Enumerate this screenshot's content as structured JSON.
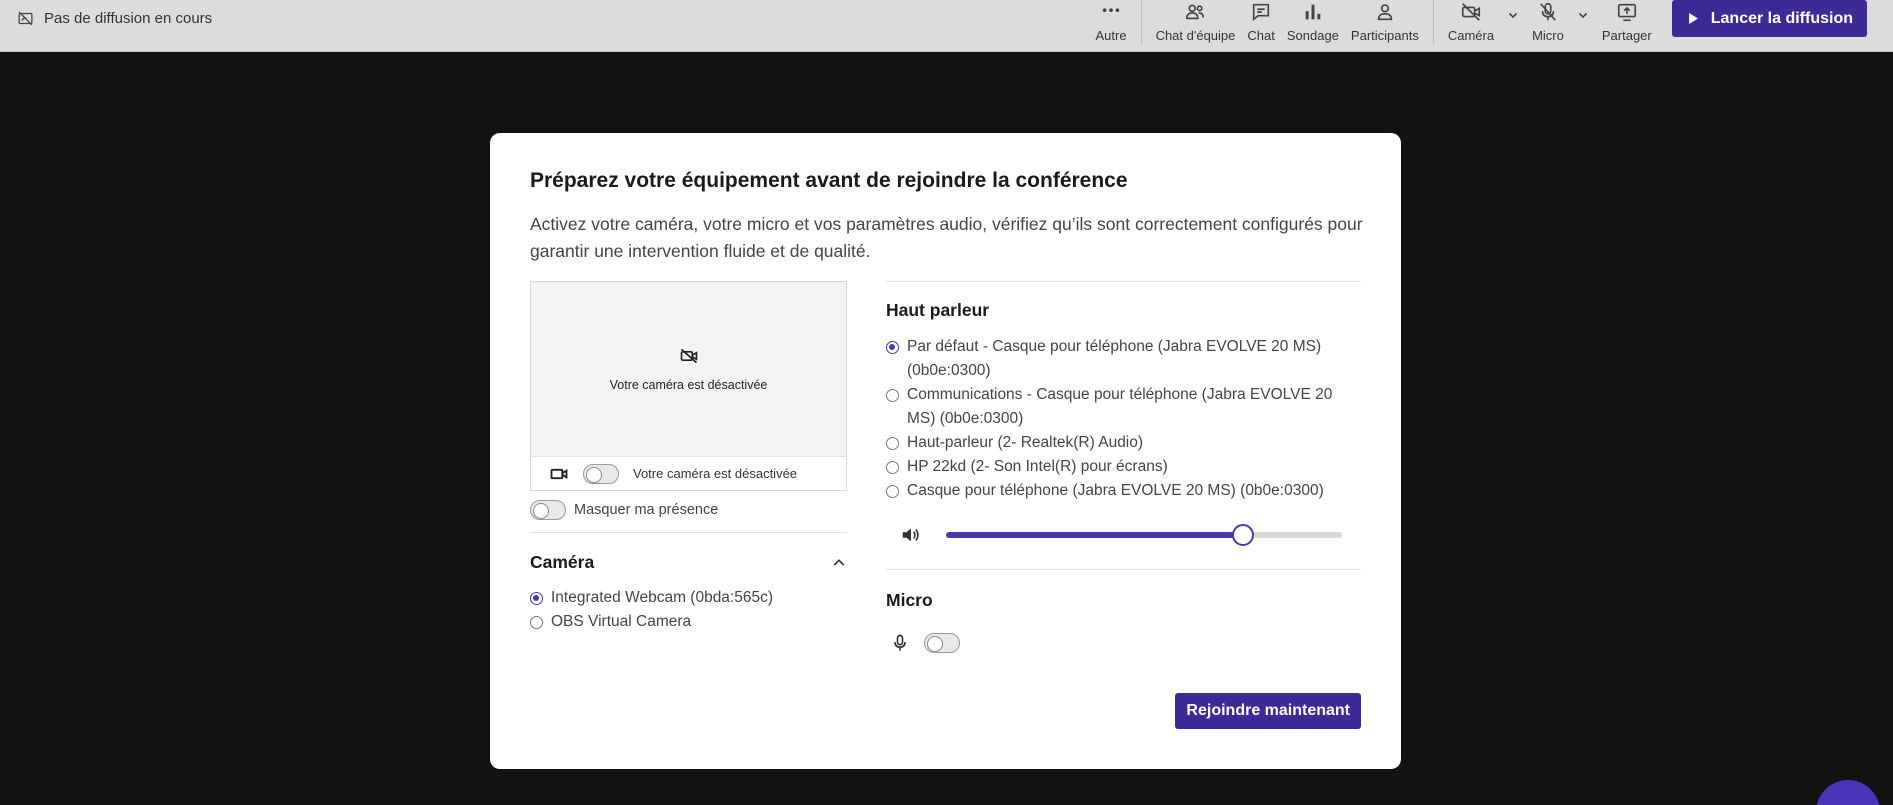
{
  "topbar": {
    "broadcast_status": "Pas de diffusion en cours",
    "tools": {
      "more": "Autre",
      "team_chat": "Chat d'équipe",
      "chat": "Chat",
      "poll": "Sondage",
      "participants": "Participants",
      "camera": "Caméra",
      "mic": "Micro",
      "share": "Partager"
    },
    "launch_label": "Lancer la diffusion"
  },
  "modal": {
    "title": "Préparez votre équipement avant de rejoindre la conférence",
    "description": "Activez votre caméra, votre micro et vos paramètres audio, vérifiez qu’ils sont correctement configurés pour garantir une intervention fluide et de qualité.",
    "preview": {
      "message": "Votre caméra est désactivée",
      "toggle_label": "Votre caméra est désactivée",
      "camera_on": false
    },
    "presence": {
      "label": "Masquer ma présence",
      "on": false
    },
    "camera_section": {
      "title": "Caméra",
      "expanded": true,
      "options": [
        {
          "label": "Integrated Webcam (0bda:565c)",
          "selected": true
        },
        {
          "label": "OBS Virtual Camera",
          "selected": false
        }
      ]
    },
    "speaker_section": {
      "title": "Haut parleur",
      "options": [
        {
          "label": "Par défaut - Casque pour téléphone (Jabra EVOLVE 20 MS) (0b0e:0300)",
          "selected": true
        },
        {
          "label": "Communications - Casque pour téléphone (Jabra EVOLVE 20 MS) (0b0e:0300)",
          "selected": false
        },
        {
          "label": "Haut-parleur (2- Realtek(R) Audio)",
          "selected": false
        },
        {
          "label": "HP 22kd (2- Son Intel(R) pour écrans)",
          "selected": false
        },
        {
          "label": "Casque pour téléphone (Jabra EVOLVE 20 MS) (0b0e:0300)",
          "selected": false
        }
      ],
      "volume": 0.75
    },
    "mic_section": {
      "title": "Micro",
      "on": false
    },
    "join_label": "Rejoindre maintenant"
  },
  "colors": {
    "accent": "#3d2a96",
    "topbar_bg": "#dcdcdc",
    "backdrop": "#121212"
  }
}
